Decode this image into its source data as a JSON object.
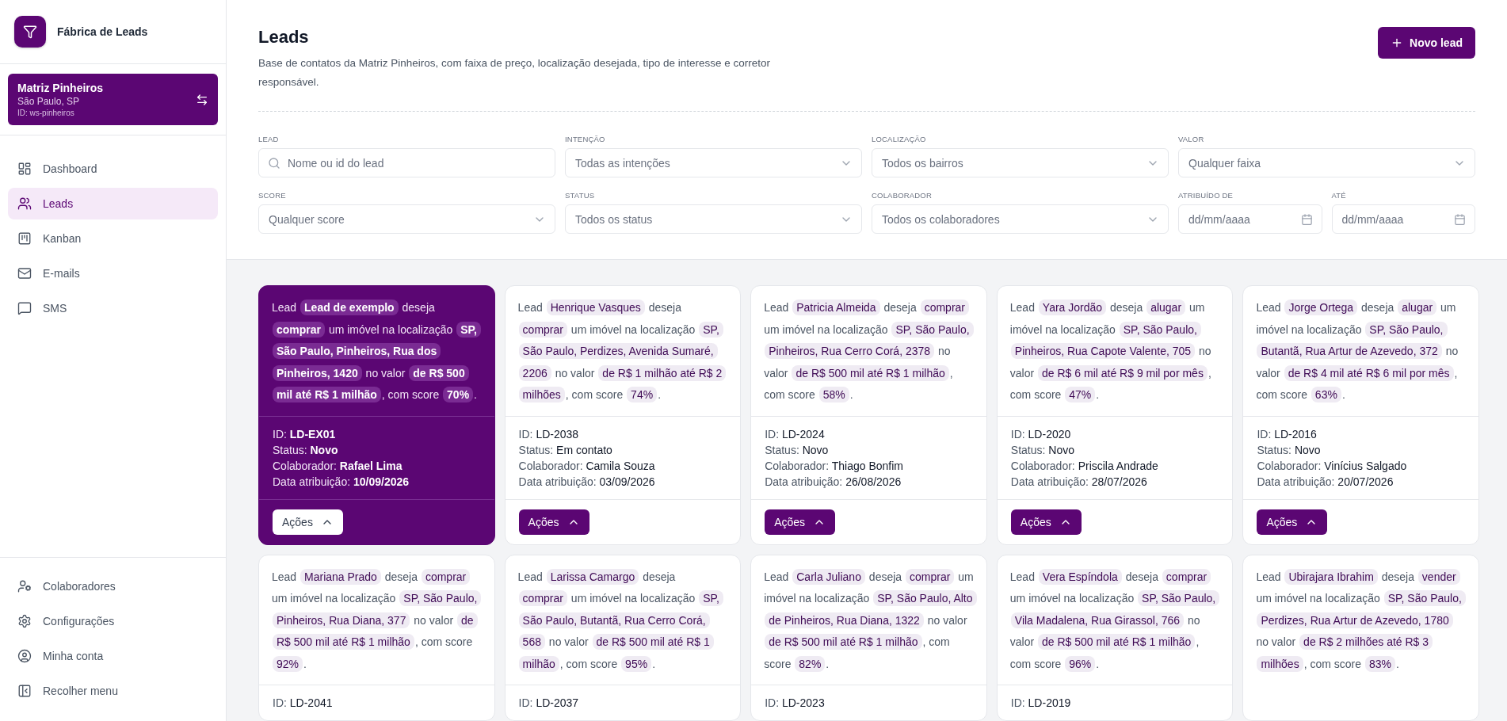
{
  "sidebar": {
    "brand": "Fábrica de Leads",
    "workspace": {
      "name": "Matriz Pinheiros",
      "city": "São Paulo, SP",
      "id": "ID: ws-pinheiros"
    },
    "nav": [
      {
        "label": "Dashboard",
        "selected": false
      },
      {
        "label": "Leads",
        "selected": true
      },
      {
        "label": "Kanban",
        "selected": false
      },
      {
        "label": "E-mails",
        "selected": false
      },
      {
        "label": "SMS",
        "selected": false
      }
    ],
    "footer_nav": [
      {
        "label": "Colaboradores"
      },
      {
        "label": "Configurações"
      },
      {
        "label": "Minha conta"
      },
      {
        "label": "Recolher menu"
      }
    ]
  },
  "header": {
    "title": "Leads",
    "description": "Base de contatos da Matriz Pinheiros, com faixa de preço, localização desejada, tipo de interesse e corretor responsável.",
    "new_button": "Novo lead"
  },
  "filters": [
    {
      "label": "LEAD",
      "placeholder": "Nome ou id do lead",
      "kind": "search"
    },
    {
      "label": "INTENÇÃO",
      "placeholder": "Todas as intenções",
      "kind": "select"
    },
    {
      "label": "LOCALIZAÇÃO",
      "placeholder": "Todos os bairros",
      "kind": "select"
    },
    {
      "label": "VALOR",
      "placeholder": "Qualquer faixa",
      "kind": "select"
    },
    {
      "label": "SCORE",
      "placeholder": "Qualquer score",
      "kind": "select"
    },
    {
      "label": "STATUS",
      "placeholder": "Todos os status",
      "kind": "select"
    },
    {
      "label": "COLABORADOR",
      "placeholder": "Todos os colaboradores",
      "kind": "select"
    },
    {
      "label": "ATRIBUÍDO DE",
      "placeholder": "dd/mm/aaaa",
      "kind": "date"
    },
    {
      "label": "ATÉ",
      "placeholder": "dd/mm/aaaa",
      "kind": "date"
    }
  ],
  "cards": [
    {
      "selected": true,
      "parts": [
        {
          "kind": "text",
          "text": "Lead"
        },
        {
          "kind": "chip",
          "text": "Lead de exemplo"
        },
        {
          "kind": "text",
          "text": "deseja"
        },
        {
          "kind": "chip",
          "text": "comprar"
        },
        {
          "kind": "text",
          "text": "um imóvel na localização"
        },
        {
          "kind": "chip",
          "text": "SP, São Paulo, Pinheiros, Rua dos Pinheiros, 1420"
        },
        {
          "kind": "text",
          "text": "no valor"
        },
        {
          "kind": "chip",
          "text": "de R$ 500 mil até R$ 1 milhão"
        },
        {
          "kind": "text",
          "text": ", com score"
        },
        {
          "kind": "chip",
          "text": "70%"
        },
        {
          "kind": "text",
          "text": "."
        }
      ],
      "fields": [
        {
          "label": "ID:",
          "value": "LD-EX01"
        },
        {
          "label": "Status:",
          "value": "Novo"
        },
        {
          "label": "Colaborador:",
          "value": "Rafael Lima"
        },
        {
          "label": "Data atribuição:",
          "value": "10/09/2026"
        }
      ],
      "action": "Ações"
    },
    {
      "selected": false,
      "parts": [
        {
          "kind": "text",
          "text": "Lead"
        },
        {
          "kind": "chip",
          "text": "Henrique Vasques"
        },
        {
          "kind": "text",
          "text": "deseja"
        },
        {
          "kind": "chip",
          "text": "comprar"
        },
        {
          "kind": "text",
          "text": "um imóvel na localização"
        },
        {
          "kind": "chip",
          "text": "SP, São Paulo, Perdizes, Avenida Sumaré, 2206"
        },
        {
          "kind": "text",
          "text": "no valor"
        },
        {
          "kind": "chip",
          "text": "de R$ 1 milhão até R$ 2 milhões"
        },
        {
          "kind": "text",
          "text": ", com score"
        },
        {
          "kind": "chip",
          "text": "74%"
        },
        {
          "kind": "text",
          "text": "."
        }
      ],
      "fields": [
        {
          "label": "ID:",
          "value": "LD-2038"
        },
        {
          "label": "Status:",
          "value": "Em contato"
        },
        {
          "label": "Colaborador:",
          "value": "Camila Souza"
        },
        {
          "label": "Data atribuição:",
          "value": "03/09/2026"
        }
      ],
      "action": "Ações"
    },
    {
      "selected": false,
      "parts": [
        {
          "kind": "text",
          "text": "Lead"
        },
        {
          "kind": "chip",
          "text": "Patricia Almeida"
        },
        {
          "kind": "text",
          "text": "deseja"
        },
        {
          "kind": "chip",
          "text": "comprar"
        },
        {
          "kind": "text",
          "text": "um imóvel na localização"
        },
        {
          "kind": "chip",
          "text": "SP, São Paulo, Pinheiros, Rua Cerro Corá, 2378"
        },
        {
          "kind": "text",
          "text": "no valor"
        },
        {
          "kind": "chip",
          "text": "de R$ 500 mil até R$ 1 milhão"
        },
        {
          "kind": "text",
          "text": ", com score"
        },
        {
          "kind": "chip",
          "text": "58%"
        },
        {
          "kind": "text",
          "text": "."
        }
      ],
      "fields": [
        {
          "label": "ID:",
          "value": "LD-2024"
        },
        {
          "label": "Status:",
          "value": "Novo"
        },
        {
          "label": "Colaborador:",
          "value": "Thiago Bonfim"
        },
        {
          "label": "Data atribuição:",
          "value": "26/08/2026"
        }
      ],
      "action": "Ações"
    },
    {
      "selected": false,
      "parts": [
        {
          "kind": "text",
          "text": "Lead"
        },
        {
          "kind": "chip",
          "text": "Yara Jordão"
        },
        {
          "kind": "text",
          "text": "deseja"
        },
        {
          "kind": "chip",
          "text": "alugar"
        },
        {
          "kind": "text",
          "text": "um imóvel na localização"
        },
        {
          "kind": "chip",
          "text": "SP, São Paulo, Pinheiros, Rua Capote Valente, 705"
        },
        {
          "kind": "text",
          "text": "no valor"
        },
        {
          "kind": "chip",
          "text": "de R$ 6 mil até R$ 9 mil por mês"
        },
        {
          "kind": "text",
          "text": ", com score"
        },
        {
          "kind": "chip",
          "text": "47%"
        },
        {
          "kind": "text",
          "text": "."
        }
      ],
      "fields": [
        {
          "label": "ID:",
          "value": "LD-2020"
        },
        {
          "label": "Status:",
          "value": "Novo"
        },
        {
          "label": "Colaborador:",
          "value": "Priscila Andrade"
        },
        {
          "label": "Data atribuição:",
          "value": "28/07/2026"
        }
      ],
      "action": "Ações"
    },
    {
      "selected": false,
      "parts": [
        {
          "kind": "text",
          "text": "Lead"
        },
        {
          "kind": "chip",
          "text": "Jorge Ortega"
        },
        {
          "kind": "text",
          "text": "deseja"
        },
        {
          "kind": "chip",
          "text": "alugar"
        },
        {
          "kind": "text",
          "text": "um imóvel na localização"
        },
        {
          "kind": "chip",
          "text": "SP, São Paulo, Butantã, Rua Artur de Azevedo, 372"
        },
        {
          "kind": "text",
          "text": "no valor"
        },
        {
          "kind": "chip",
          "text": "de R$ 4 mil até R$ 6 mil por mês"
        },
        {
          "kind": "text",
          "text": ", com score"
        },
        {
          "kind": "chip",
          "text": "63%"
        },
        {
          "kind": "text",
          "text": "."
        }
      ],
      "fields": [
        {
          "label": "ID:",
          "value": "LD-2016"
        },
        {
          "label": "Status:",
          "value": "Novo"
        },
        {
          "label": "Colaborador:",
          "value": "Vinícius Salgado"
        },
        {
          "label": "Data atribuição:",
          "value": "20/07/2026"
        }
      ],
      "action": "Ações"
    },
    {
      "selected": false,
      "parts": [
        {
          "kind": "text",
          "text": "Lead"
        },
        {
          "kind": "chip",
          "text": "Mariana Prado"
        },
        {
          "kind": "text",
          "text": "deseja"
        },
        {
          "kind": "chip",
          "text": "comprar"
        },
        {
          "kind": "text",
          "text": "um imóvel na localização"
        },
        {
          "kind": "chip",
          "text": "SP, São Paulo, Pinheiros, Rua Diana, 377"
        },
        {
          "kind": "text",
          "text": "no valor"
        },
        {
          "kind": "chip",
          "text": "de R$ 500 mil até R$ 1 milhão"
        },
        {
          "kind": "text",
          "text": ", com score"
        },
        {
          "kind": "chip",
          "text": "92%"
        },
        {
          "kind": "text",
          "text": "."
        }
      ],
      "fields": [
        {
          "label": "ID:",
          "value": "LD-2041"
        }
      ]
    },
    {
      "selected": false,
      "parts": [
        {
          "kind": "text",
          "text": "Lead"
        },
        {
          "kind": "chip",
          "text": "Larissa Camargo"
        },
        {
          "kind": "text",
          "text": "deseja"
        },
        {
          "kind": "chip",
          "text": "comprar"
        },
        {
          "kind": "text",
          "text": "um imóvel na localização"
        },
        {
          "kind": "chip",
          "text": "SP, São Paulo, Butantã, Rua Cerro Corá, 568"
        },
        {
          "kind": "text",
          "text": "no valor"
        },
        {
          "kind": "chip",
          "text": "de R$ 500 mil até R$ 1 milhão"
        },
        {
          "kind": "text",
          "text": ", com score"
        },
        {
          "kind": "chip",
          "text": "95%"
        },
        {
          "kind": "text",
          "text": "."
        }
      ],
      "fields": [
        {
          "label": "ID:",
          "value": "LD-2037"
        }
      ]
    },
    {
      "selected": false,
      "parts": [
        {
          "kind": "text",
          "text": "Lead"
        },
        {
          "kind": "chip",
          "text": "Carla Juliano"
        },
        {
          "kind": "text",
          "text": "deseja"
        },
        {
          "kind": "chip",
          "text": "comprar"
        },
        {
          "kind": "text",
          "text": "um imóvel na localização"
        },
        {
          "kind": "chip",
          "text": "SP, São Paulo, Alto de Pinheiros, Rua Diana, 1322"
        },
        {
          "kind": "text",
          "text": "no valor"
        },
        {
          "kind": "chip",
          "text": "de R$ 500 mil até R$ 1 milhão"
        },
        {
          "kind": "text",
          "text": ", com score"
        },
        {
          "kind": "chip",
          "text": "82%"
        },
        {
          "kind": "text",
          "text": "."
        }
      ],
      "fields": [
        {
          "label": "ID:",
          "value": "LD-2023"
        }
      ]
    },
    {
      "selected": false,
      "parts": [
        {
          "kind": "text",
          "text": "Lead"
        },
        {
          "kind": "chip",
          "text": "Vera Espíndola"
        },
        {
          "kind": "text",
          "text": "deseja"
        },
        {
          "kind": "chip",
          "text": "comprar"
        },
        {
          "kind": "text",
          "text": "um imóvel na localização"
        },
        {
          "kind": "chip",
          "text": "SP, São Paulo, Vila Madalena, Rua Girassol, 766"
        },
        {
          "kind": "text",
          "text": "no valor"
        },
        {
          "kind": "chip",
          "text": "de R$ 500 mil até R$ 1 milhão"
        },
        {
          "kind": "text",
          "text": ", com score"
        },
        {
          "kind": "chip",
          "text": "96%"
        },
        {
          "kind": "text",
          "text": "."
        }
      ],
      "fields": [
        {
          "label": "ID:",
          "value": "LD-2019"
        }
      ]
    },
    {
      "selected": false,
      "parts": [
        {
          "kind": "text",
          "text": "Lead"
        },
        {
          "kind": "chip",
          "text": "Ubirajara Ibrahim"
        },
        {
          "kind": "text",
          "text": "deseja"
        },
        {
          "kind": "chip",
          "text": "vender"
        },
        {
          "kind": "text",
          "text": "um imóvel na localização"
        },
        {
          "kind": "chip",
          "text": "SP, São Paulo, Perdizes, Rua Artur de Azevedo, 1780"
        },
        {
          "kind": "text",
          "text": "no valor"
        },
        {
          "kind": "chip",
          "text": "de R$ 2 milhões até R$ 3 milhões"
        },
        {
          "kind": "text",
          "text": ", com score"
        },
        {
          "kind": "chip",
          "text": "83%"
        },
        {
          "kind": "text",
          "text": "."
        }
      ]
    }
  ]
}
